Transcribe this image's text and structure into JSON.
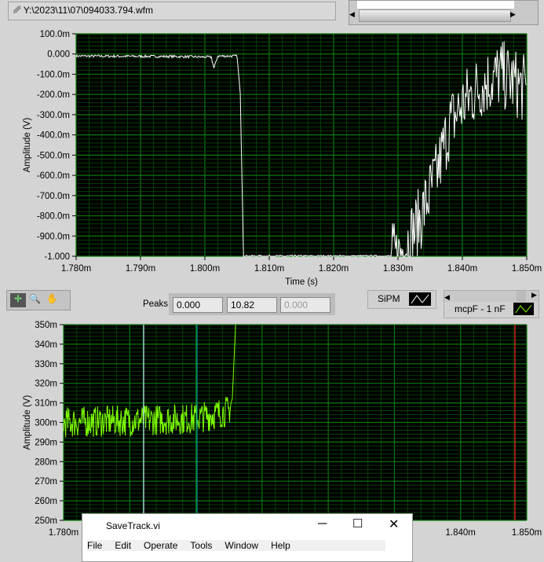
{
  "file_path": "Y:\\2023\\11\\07\\094033.794.wfm",
  "peaks": {
    "label": "Peaks",
    "values": [
      "0.000",
      "10.82",
      "0.000"
    ]
  },
  "legend": {
    "sipm": "SiPM",
    "mcp": "mcpF - 1 nF"
  },
  "colors": {
    "plot_bg": "#000000",
    "grid": "#0a7a0a",
    "trace1": "#ffffff",
    "trace2": "#7fff00",
    "cursor_a": "#c8f0ff",
    "cursor_b": "#00a0a0",
    "cursor_c": "#ff2020"
  },
  "window": {
    "title": "SaveTrack.vi",
    "menu": [
      "File",
      "Edit",
      "Operate",
      "Tools",
      "Window",
      "Help"
    ]
  },
  "chart_data": [
    {
      "type": "line",
      "title": "",
      "xlabel": "Time (s)",
      "ylabel": "Amplitude (V)",
      "xlim": [
        1.78,
        1.85
      ],
      "ylim": [
        -1.0,
        0.1
      ],
      "xticks": [
        "1.780m",
        "1.790m",
        "1.800m",
        "1.810m",
        "1.820m",
        "1.830m",
        "1.840m",
        "1.850m"
      ],
      "yticks": [
        "100.0m",
        "0.000",
        "-100.0m",
        "-200.0m",
        "-300.0m",
        "-400.0m",
        "-500.0m",
        "-600.0m",
        "-700.0m",
        "-800.0m",
        "-900.0m",
        "-1.000"
      ],
      "series": [
        {
          "name": "SiPM",
          "x": [
            1.78,
            1.795,
            1.801,
            1.8014,
            1.802,
            1.805,
            1.8055,
            1.806,
            1.83,
            1.833,
            1.836,
            1.838,
            1.84,
            1.843,
            1.846,
            1.85
          ],
          "y": [
            -0.01,
            -0.012,
            -0.015,
            -0.07,
            -0.01,
            -0.01,
            -0.2,
            -1.0,
            -1.0,
            -0.85,
            -0.6,
            -0.35,
            -0.25,
            -0.15,
            -0.1,
            -0.18
          ]
        }
      ]
    },
    {
      "type": "line",
      "xlabel": "",
      "ylabel": "Amplitude (V)",
      "xlim": [
        1.78,
        1.85
      ],
      "ylim": [
        0.25,
        0.35
      ],
      "xticks": [
        "1.780m",
        "1.840m",
        "1.850m"
      ],
      "yticks": [
        "350m",
        "340m",
        "330m",
        "320m",
        "310m",
        "300m",
        "290m",
        "280m",
        "270m",
        "260m",
        "250m"
      ],
      "series": [
        {
          "name": "mcpF - 1 nF",
          "x": [
            1.78,
            1.8,
            1.805,
            1.8055,
            1.806
          ],
          "y": [
            0.3,
            0.302,
            0.306,
            0.312,
            0.35
          ]
        }
      ]
    }
  ]
}
